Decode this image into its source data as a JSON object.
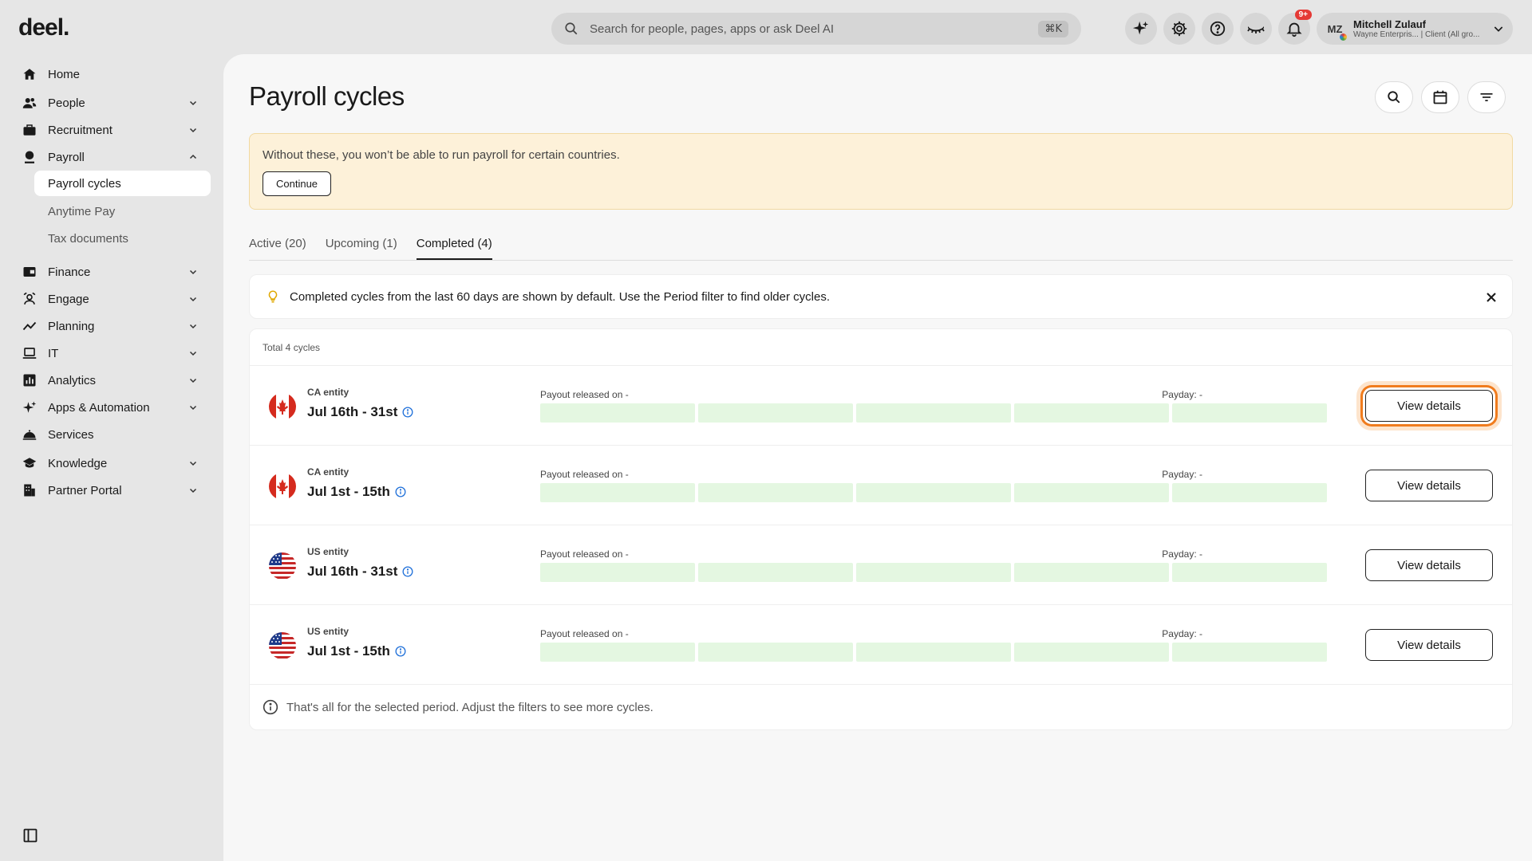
{
  "brand": {
    "logo": "deel."
  },
  "search": {
    "placeholder": "Search for people, pages, apps or ask Deel AI",
    "shortcut": "⌘K"
  },
  "notifications": {
    "badge": "9+"
  },
  "user": {
    "initials": "MZ",
    "name": "Mitchell Zulauf",
    "org": "Wayne Enterpris... | Client (All gro..."
  },
  "sidebar": {
    "items": [
      {
        "label": "Home",
        "icon": "home-icon"
      },
      {
        "label": "People",
        "icon": "people-icon"
      },
      {
        "label": "Recruitment",
        "icon": "briefcase-icon"
      },
      {
        "label": "Payroll",
        "icon": "payroll-icon"
      },
      {
        "label": "Finance",
        "icon": "wallet-icon"
      },
      {
        "label": "Engage",
        "icon": "engage-icon"
      },
      {
        "label": "Planning",
        "icon": "trend-icon"
      },
      {
        "label": "IT",
        "icon": "laptop-icon"
      },
      {
        "label": "Analytics",
        "icon": "bar-chart-icon"
      },
      {
        "label": "Apps & Automation",
        "icon": "sparkle-icon"
      },
      {
        "label": "Services",
        "icon": "cloche-icon"
      },
      {
        "label": "Knowledge",
        "icon": "graduation-cap-icon"
      },
      {
        "label": "Partner Portal",
        "icon": "building-icon"
      }
    ],
    "payroll_sub": [
      "Payroll cycles",
      "Anytime Pay",
      "Tax documents"
    ]
  },
  "page": {
    "title": "Payroll cycles"
  },
  "banner": {
    "text": "Without these, you won’t be able to run payroll for certain countries.",
    "button": "Continue"
  },
  "tabs": [
    "Active (20)",
    "Upcoming (1)",
    "Completed (4)"
  ],
  "info": {
    "text": "Completed cycles from the last 60 days are shown by default. Use the Period filter to find older cycles."
  },
  "list": {
    "total": "Total 4 cycles",
    "rows": [
      {
        "entity": "CA entity",
        "period": "Jul 16th - 31st",
        "payout": "Payout released on -",
        "payday": "Payday: -",
        "button": "View details",
        "flag": "canada-flag-icon"
      },
      {
        "entity": "CA entity",
        "period": "Jul 1st - 15th",
        "payout": "Payout released on -",
        "payday": "Payday: -",
        "button": "View details",
        "flag": "canada-flag-icon"
      },
      {
        "entity": "US entity",
        "period": "Jul 16th - 31st",
        "payout": "Payout released on -",
        "payday": "Payday: -",
        "button": "View details",
        "flag": "us-flag-icon"
      },
      {
        "entity": "US entity",
        "period": "Jul 1st - 15th",
        "payout": "Payout released on -",
        "payday": "Payday: -",
        "button": "View details",
        "flag": "us-flag-icon"
      }
    ],
    "footer": "That's all for the selected period. Adjust the filters to see more cycles."
  },
  "colors": {
    "accent_focus": "#f07c1e",
    "progress_fill": "#e4f7e1",
    "banner_bg": "#fdf1d9"
  }
}
